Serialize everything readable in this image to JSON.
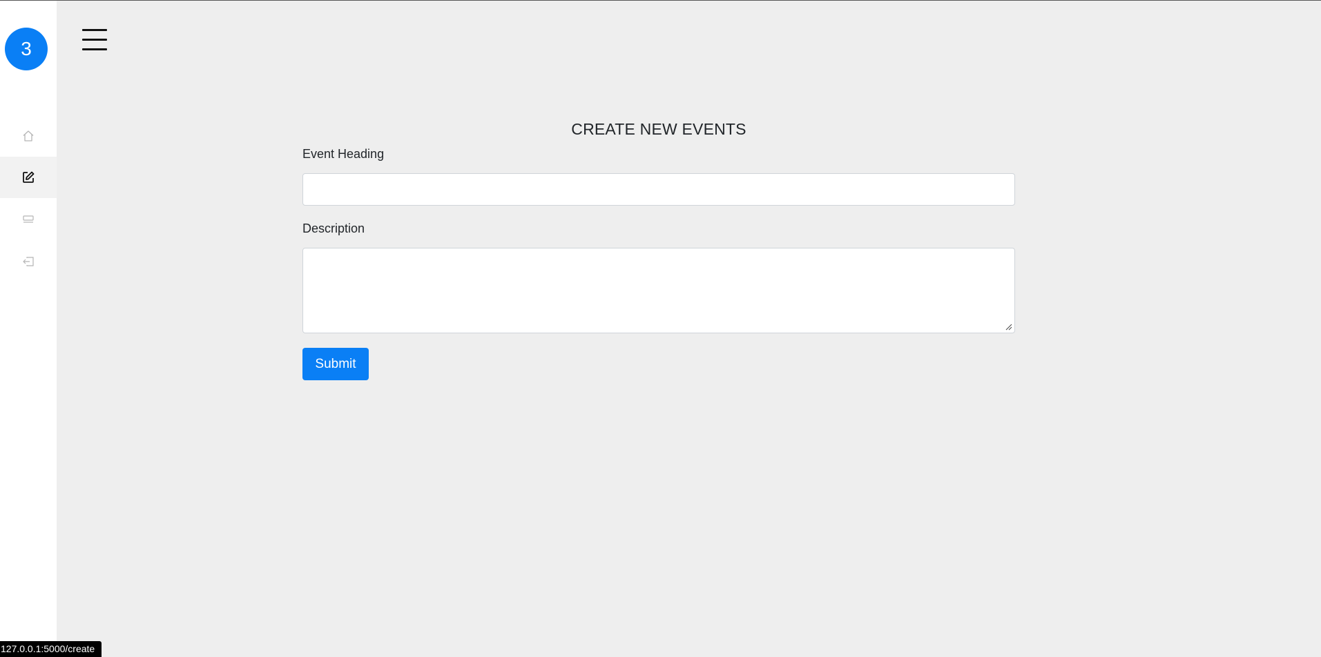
{
  "sidebar": {
    "avatar_text": "3",
    "items": [
      {
        "name": "home",
        "icon": "home-icon",
        "active": false
      },
      {
        "name": "create",
        "icon": "edit-icon",
        "active": true
      },
      {
        "name": "events",
        "icon": "list-icon",
        "active": false
      },
      {
        "name": "logout",
        "icon": "logout-icon",
        "active": false
      }
    ]
  },
  "header": {
    "menu_icon": "hamburger-menu-icon"
  },
  "form": {
    "title": "CREATE NEW EVENTS",
    "heading_label": "Event Heading",
    "heading_value": "",
    "description_label": "Description",
    "description_value": "",
    "submit_label": "Submit"
  },
  "status_bar": {
    "url": "127.0.0.1:5000/create"
  },
  "colors": {
    "accent": "#0a7ff5",
    "background": "#eeeeee",
    "sidebar": "#ffffff"
  }
}
